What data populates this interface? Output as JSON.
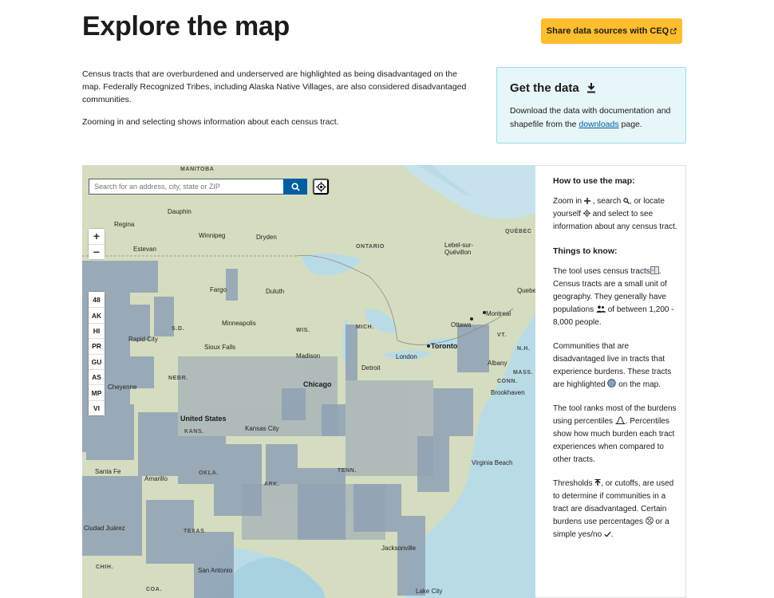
{
  "header": {
    "title": "Explore the map",
    "share_button": "Share data sources with CEQ"
  },
  "intro": {
    "paragraph1": "Census tracts that are overburdened and underserved are highlighted as being disadvantaged on the map. Federally Recognized Tribes, including Alaska Native Villages, are also considered disadvantaged communities.",
    "paragraph2": "Zooming in and selecting shows information about each census tract."
  },
  "get_data": {
    "title": "Get the data",
    "text_before_link": "Download the data with documentation and shapefile from the ",
    "link": "downloads",
    "text_after_link": " page."
  },
  "map": {
    "search_placeholder": "Search for an address, city, state or ZIP",
    "zoom_in": "+",
    "zoom_out": "−",
    "territories": [
      "48",
      "AK",
      "HI",
      "PR",
      "GU",
      "AS",
      "MP",
      "VI"
    ],
    "labels": {
      "manitoba": "MANITOBA",
      "ontario": "ONTARIO",
      "quebec_prov": "QUÉBEC",
      "dauphin": "Dauphin",
      "regina": "Regina",
      "winnipeg": "Winnipeg",
      "dryden": "Dryden",
      "estevan": "Estevan",
      "lebel": "Lebel-sur-\nQuévillon",
      "fargo": "Fargo",
      "duluth": "Duluth",
      "quebec_city": "Quebec",
      "sd": "S.D.",
      "minneapolis": "Minneapolis",
      "wis": "WIS.",
      "mich": "MICH.",
      "ottawa": "Ottawa",
      "montreal": "Montreal",
      "vt": "VT.",
      "nh": "N.H.",
      "rapid_city": "Rapid City",
      "sioux_falls": "Sioux Falls",
      "madison": "Madison",
      "london": "London",
      "toronto": "Toronto",
      "albany": "Albany",
      "mass": "MASS.",
      "nebr": "NEBR.",
      "cheyenne": "Cheyenne",
      "detroit": "Detroit",
      "conn": "CONN.",
      "brockhaven": "Brookhaven",
      "chicago": "Chicago",
      "united_states": "United States",
      "kans": "KANS.",
      "kansas_city": "Kansas City",
      "santa_fe": "Santa Fe",
      "amarillo": "Amarillo",
      "okla": "OKLA.",
      "ark": "ARK.",
      "tenn": "TENN.",
      "virginia_beach": "Virginia Beach",
      "juarez": "Ciudad Juárez",
      "texas": "TEXAS",
      "jacksonville": "Jacksonville",
      "chih": "CHIH.",
      "san_antonio": "San Antonio",
      "coa": "COA.",
      "lake_city": "Lake City"
    }
  },
  "sidebar": {
    "how_title": "How to use the map:",
    "how_1": "Zoom in",
    "how_2": ", search",
    "how_3": ", or locate yourself",
    "how_4": " and select to see information about any census tract.",
    "things_title": "Things to know:",
    "p1a": "The tool uses census tracts",
    "p1b": ". Census tracts are a small unit of geography. They generally have populations",
    "p1c": " of between 1,200 - 8,000 people.",
    "p2a": "Communities that are disadvantaged live in tracts that experience burdens. These tracts are highlighted",
    "p2b": " on the map.",
    "p3a": "The tool ranks most of the burdens using percentiles",
    "p3b": ". Percentiles show how much burden each tract experiences when compared to other tracts.",
    "p4a": "Thresholds",
    "p4b": ", or cutoffs, are used to determine if communities in a tract are disadvantaged. Certain burdens use percentages",
    "p4c": " or a simple yes/no",
    "p4d": "."
  },
  "colors": {
    "accent_yellow": "#ffbe2e",
    "primary_blue": "#005ea2",
    "info_bg": "#e7f6f8",
    "info_border": "#99deea",
    "land": "#d5ddc0",
    "disadvantaged_tract": "#8fa1b5",
    "water": "#b9dbe6"
  }
}
